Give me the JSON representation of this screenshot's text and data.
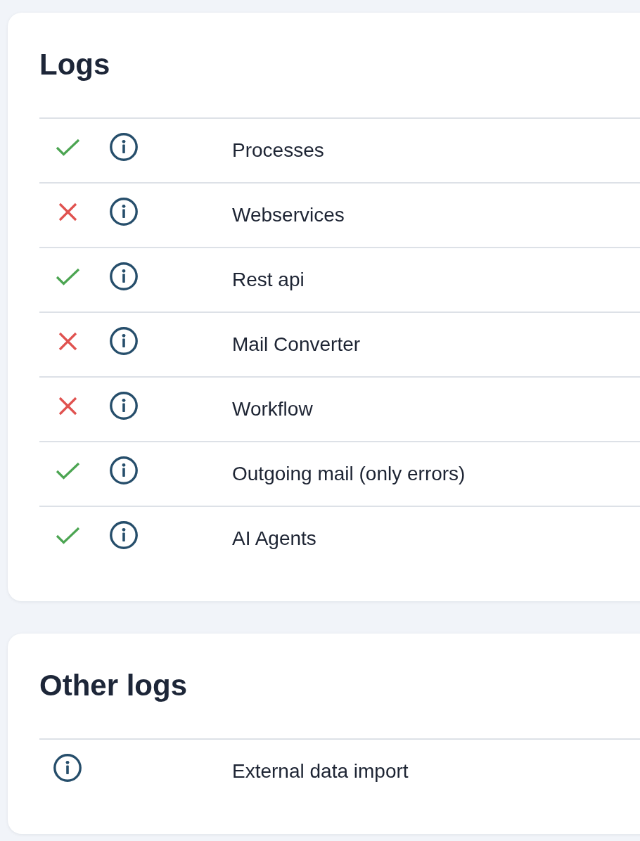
{
  "logs": {
    "title": "Logs",
    "rows": [
      {
        "enabled": true,
        "label": "Processes"
      },
      {
        "enabled": false,
        "label": "Webservices"
      },
      {
        "enabled": true,
        "label": "Rest api"
      },
      {
        "enabled": false,
        "label": "Mail Converter"
      },
      {
        "enabled": false,
        "label": "Workflow"
      },
      {
        "enabled": true,
        "label": "Outgoing mail (only errors)"
      },
      {
        "enabled": true,
        "label": "AI Agents"
      }
    ]
  },
  "other_logs": {
    "title": "Other logs",
    "rows": [
      {
        "label": "External data import"
      }
    ]
  }
}
